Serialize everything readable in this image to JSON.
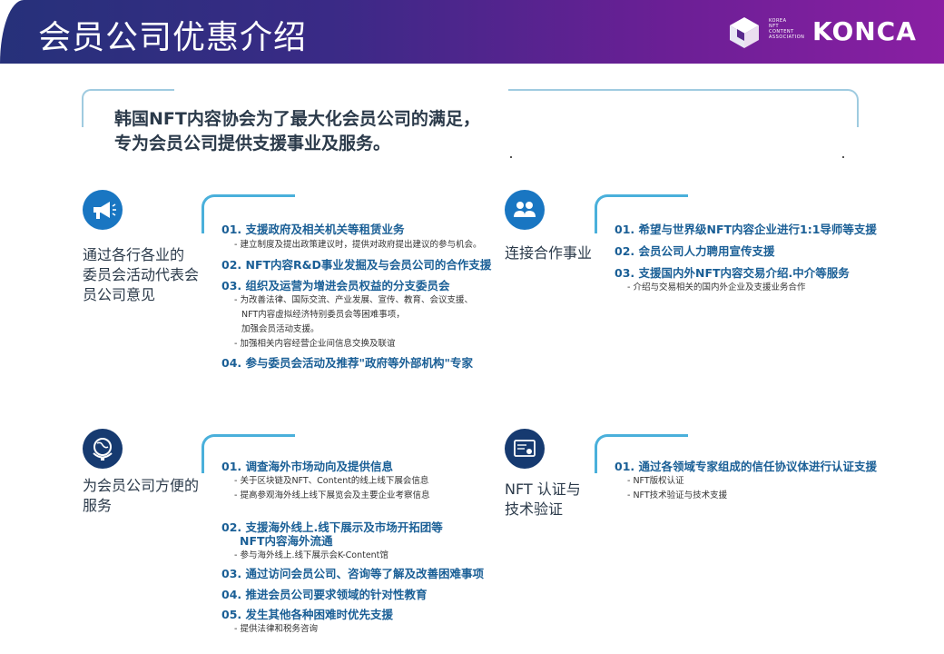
{
  "header": {
    "title": "会员公司优惠介绍",
    "logo_small": [
      "KOREA",
      "NFT",
      "CONTENT",
      "ASSOCIATION"
    ],
    "logo_text": "KONCA"
  },
  "intro": {
    "line1": "韩国NFT内容协会为了最大化会员公司的满足，",
    "line2": "专为会员公司提供支援事业及服务。"
  },
  "sections": [
    {
      "icon": "megaphone-icon",
      "label_lines": [
        "通过各行各业的",
        "委员会活动代表会",
        "员公司意见"
      ],
      "items": [
        {
          "title": "01. 支援政府及相关机关等租赁业务",
          "subs": [
            "- 建立制度及提出政策建议时，提供对政府提出建议的参与机会。"
          ]
        },
        {
          "title": "02. NFT内容R&D事业发掘及与会员公司的合作支援",
          "subs": []
        },
        {
          "title": "03. 组织及运营为增进会员权益的分支委员会",
          "subs": [
            "- 为改善法律、国际交流、产业发展、宣传、教育、会议支援、",
            "NFT内容虚拟经济特别委员会等困难事项，",
            "加强会员活动支援。",
            "- 加强相关内容经营企业间信息交换及联谊"
          ]
        },
        {
          "title": "04. 参与委员会活动及推荐\"政府等外部机构\"专家",
          "subs": []
        }
      ]
    },
    {
      "icon": "handshake-icon",
      "label_lines": [
        "连接合作事业"
      ],
      "items": [
        {
          "title": "01. 希望与世界级NFT内容企业进行1:1导师等支援",
          "subs": []
        },
        {
          "title": "02. 会员公司人力聘用宣传支援",
          "subs": []
        },
        {
          "title": "03. 支援国内外NFT内容交易介绍.中介等服务",
          "subs": [
            "- 介绍与交易相关的国内外企业及支援业务合作"
          ]
        }
      ]
    },
    {
      "icon": "globe-icon",
      "label_lines": [
        "为会员公司方便的",
        "服务"
      ],
      "items": [
        {
          "title": "01. 调查海外市场动向及提供信息",
          "subs": [
            "- 关于区块链及NFT、Content的线上线下展会信息",
            "- 提高参观海外线上线下展览会及主要企业考察信息"
          ]
        },
        {
          "title": "02. 支援海外线上.线下展示及市场开拓团等",
          "title2": "NFT内容海外流通",
          "subs": [
            "- 参与海外线上.线下展示会K-Content馆"
          ]
        },
        {
          "title": "03. 通过访问会员公司、咨询等了解及改善困难事项",
          "subs": []
        },
        {
          "title": "04. 推进会员公司要求领域的针对性教育",
          "subs": []
        },
        {
          "title": "05. 发生其他各种困难时优先支援",
          "subs": [
            "- 提供法律和税务咨询"
          ]
        }
      ]
    },
    {
      "icon": "certificate-icon",
      "label_lines": [
        "NFT 认证与",
        "技术验证"
      ],
      "items": [
        {
          "title": "01. 通过各领域专家组成的信任协议体进行认证支援",
          "subs": [
            "- NFT版权认证",
            "- NFT技术验证与技术支援"
          ]
        }
      ]
    }
  ]
}
